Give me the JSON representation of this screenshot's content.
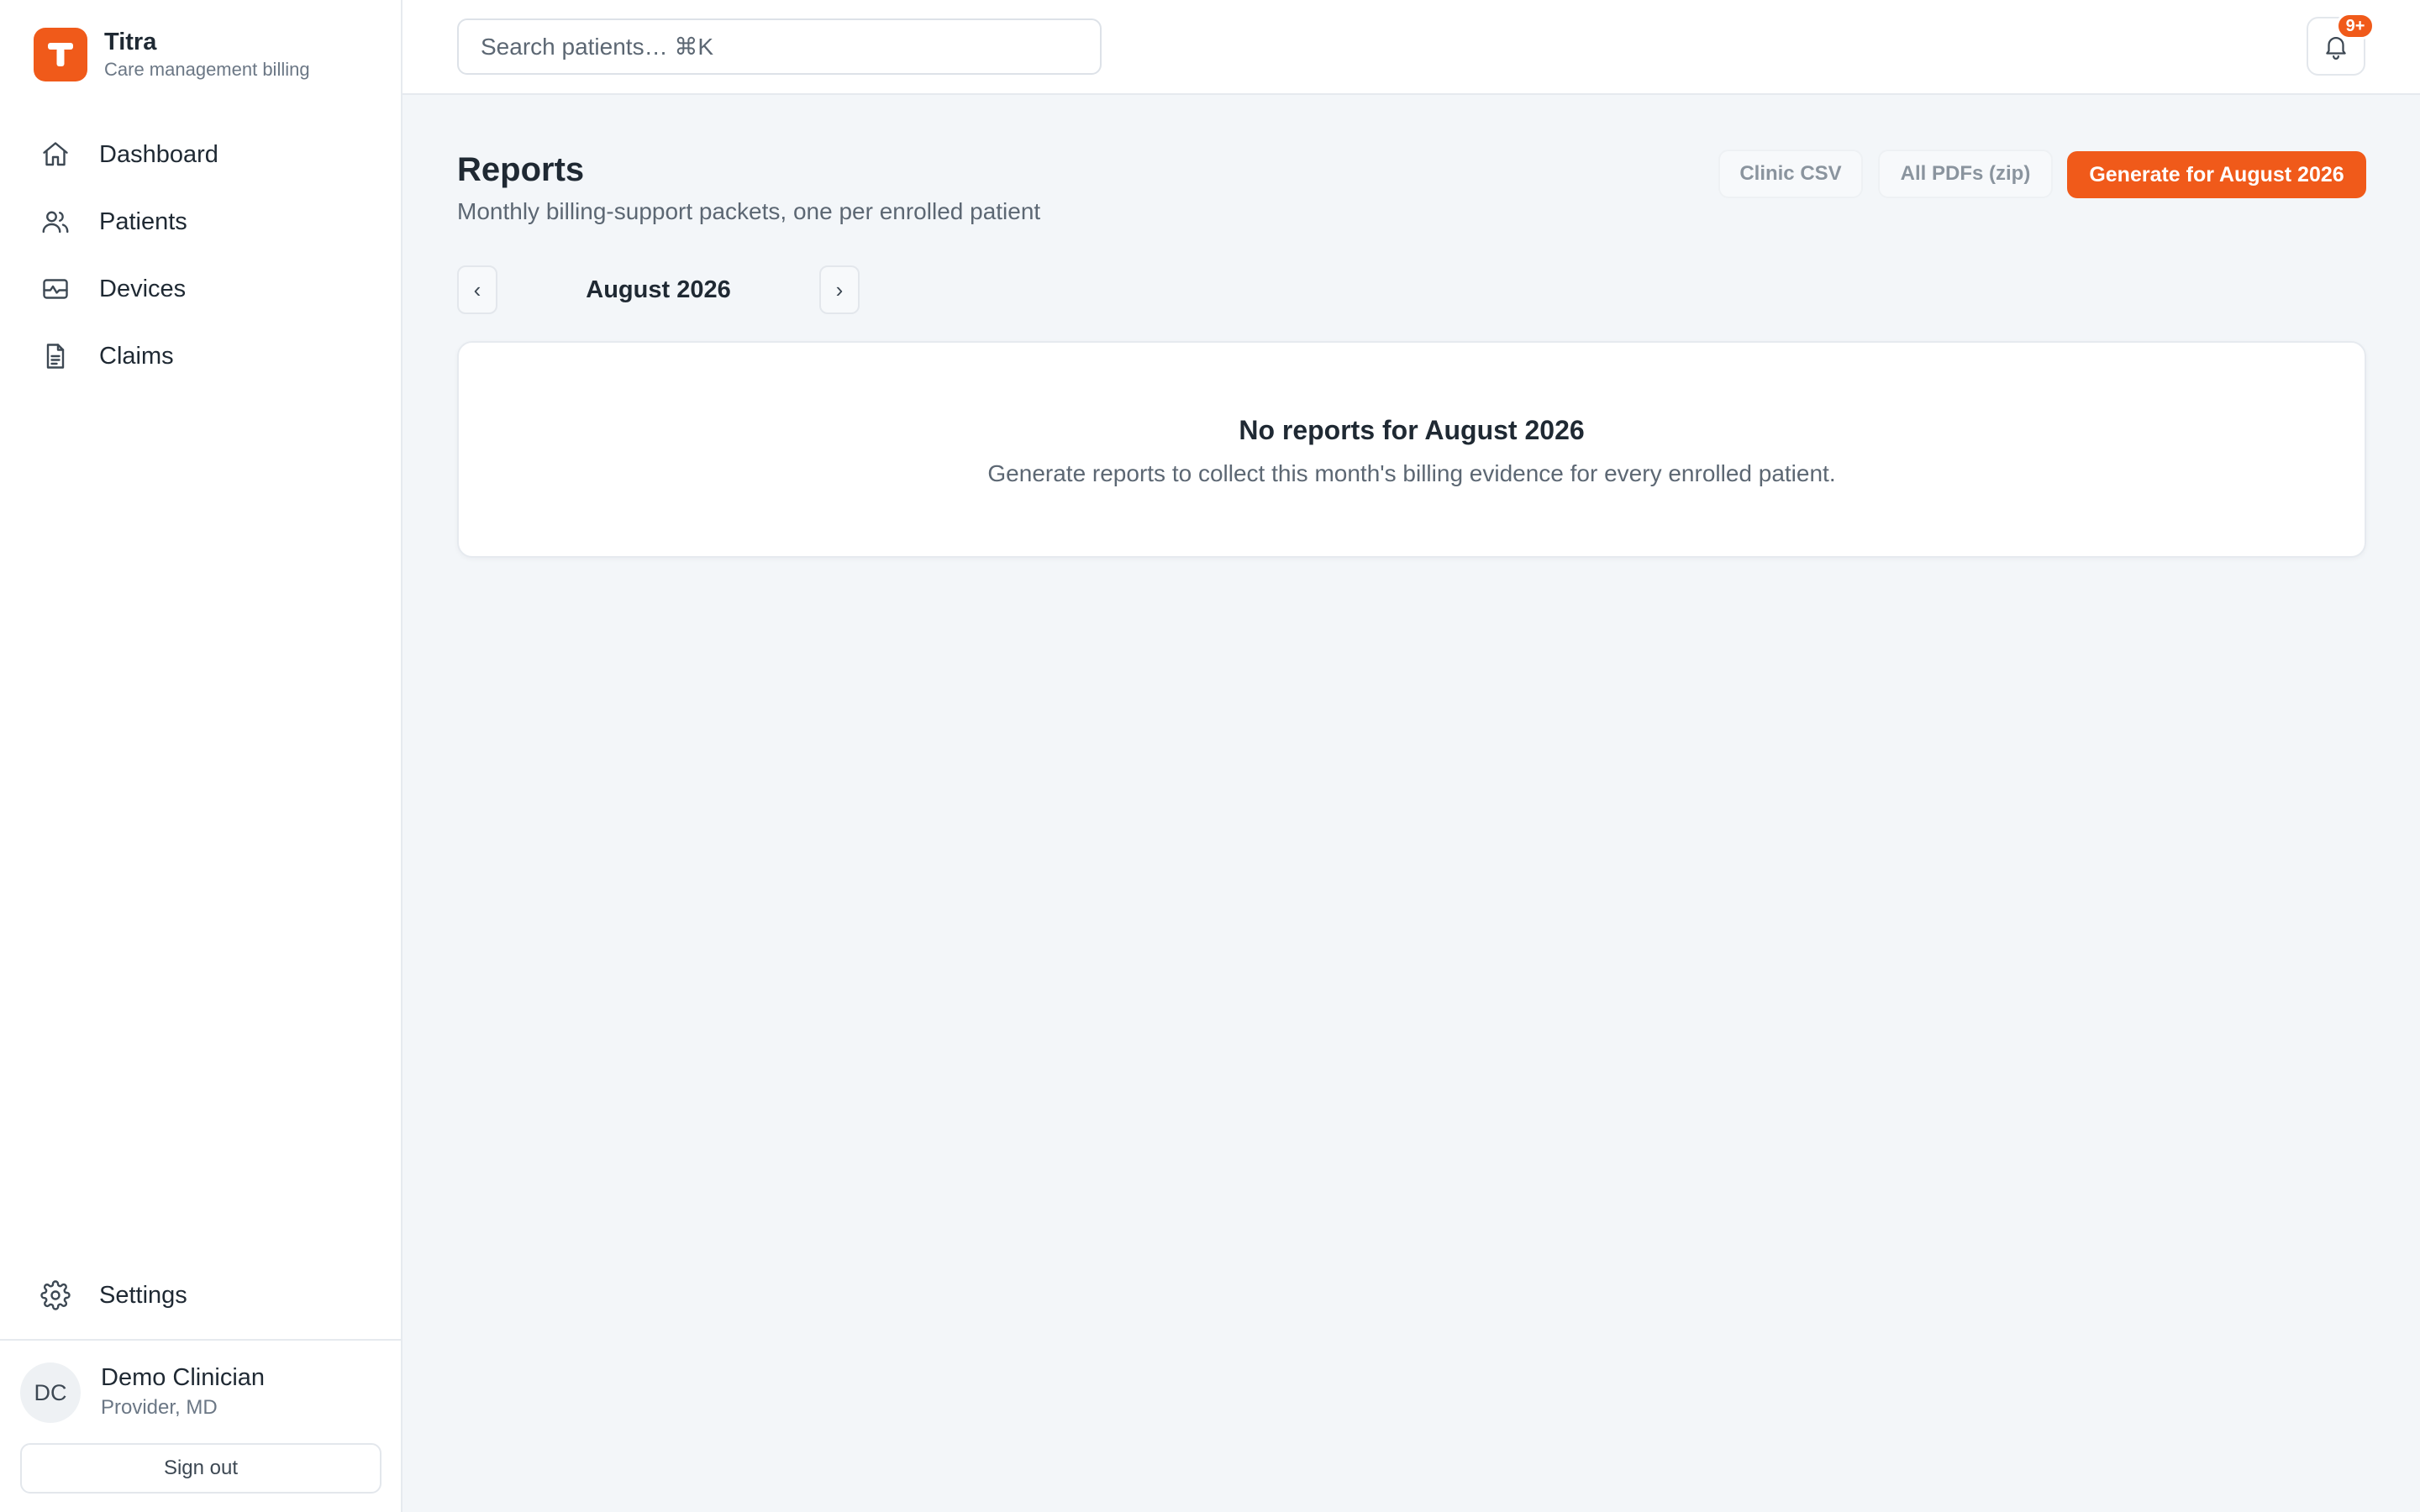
{
  "brand": {
    "name": "Titra",
    "subtitle": "Care management billing",
    "logo_letter": "T",
    "accent_color": "#f05a1a"
  },
  "sidebar": {
    "items": [
      {
        "label": "Dashboard",
        "icon": "home-icon"
      },
      {
        "label": "Patients",
        "icon": "users-icon"
      },
      {
        "label": "Devices",
        "icon": "device-icon"
      },
      {
        "label": "Claims",
        "icon": "document-icon"
      }
    ],
    "settings": {
      "label": "Settings",
      "icon": "gear-icon"
    }
  },
  "user": {
    "initials": "DC",
    "name": "Demo Clinician",
    "role": "Provider, MD",
    "sign_out_label": "Sign out"
  },
  "topbar": {
    "search_placeholder": "Search patients…  ⌘K",
    "notification_badge": "9+"
  },
  "page": {
    "title": "Reports",
    "subtitle": "Monthly billing-support packets, one per enrolled patient",
    "actions": {
      "clinic_csv": "Clinic CSV",
      "all_pdfs": "All PDFs (zip)",
      "generate": "Generate for August 2026"
    },
    "month": {
      "label": "August 2026",
      "prev": "‹",
      "next": "›"
    },
    "empty_state": {
      "title": "No reports for August 2026",
      "description": "Generate reports to collect this month's billing evidence for every enrolled patient."
    }
  }
}
